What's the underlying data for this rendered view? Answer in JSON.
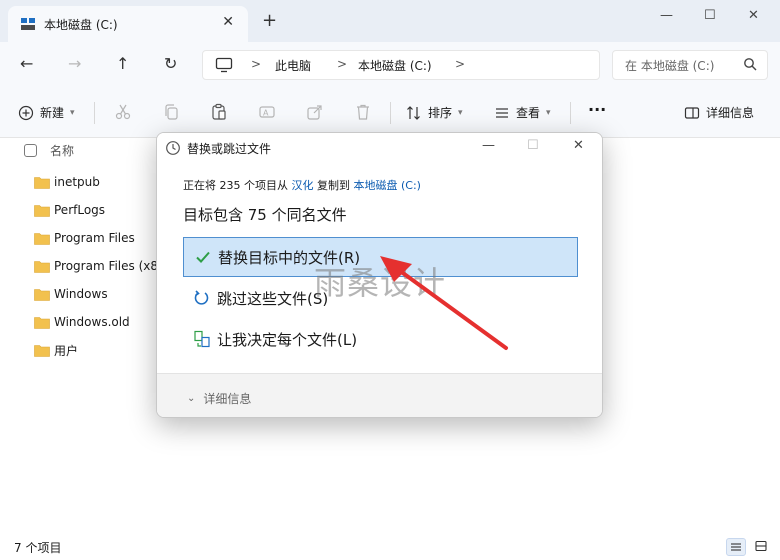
{
  "tab": {
    "title": "本地磁盘 (C:)",
    "close": "✕",
    "add": "+"
  },
  "window_controls": {
    "minimize": "—",
    "maximize": "☐",
    "close": "✕"
  },
  "nav": {
    "back": "←",
    "forward": "→",
    "up": "↑",
    "refresh": "↻",
    "breadcrumbs": [
      "此电脑",
      "本地磁盘 (C:)"
    ],
    "separator": ">",
    "search_placeholder": "在 本地磁盘 (C:)"
  },
  "toolbar": {
    "new_label": "新建",
    "sort_label": "排序",
    "view_label": "查看",
    "more": "···",
    "details_label": "详细信息"
  },
  "filelist": {
    "column_name": "名称",
    "items": [
      "inetpub",
      "PerfLogs",
      "Program Files",
      "Program Files (x8",
      "Windows",
      "Windows.old",
      "用户"
    ]
  },
  "status": {
    "count": "7 个项目"
  },
  "dialog": {
    "title": "替换或跳过文件",
    "progress_prefix": "正在将 235 个项目从",
    "progress_source": "汉化",
    "progress_middle": "复制到",
    "progress_dest": "本地磁盘 (C:)",
    "heading": "目标包含 75 个同名文件",
    "options": [
      {
        "label": "替换目标中的文件(R)",
        "selected": true
      },
      {
        "label": "跳过这些文件(S)",
        "selected": false
      },
      {
        "label": "让我决定每个文件(L)",
        "selected": false
      }
    ],
    "details": "详细信息"
  },
  "watermark": "雨桑设计",
  "colors": {
    "accent": "#0a5ab0",
    "selection_bg": "#cfe5f9",
    "selection_border": "#4f8fd0",
    "folder": "#f2c14e",
    "arrow": "#e5302f"
  }
}
